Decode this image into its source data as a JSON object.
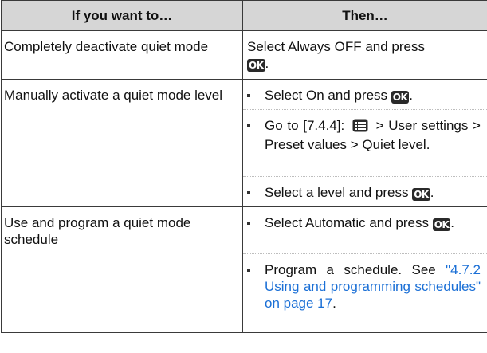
{
  "header": {
    "col1": "If you want to…",
    "col2": "Then…"
  },
  "rows": [
    {
      "want": "Completely deactivate quiet mode",
      "then": {
        "text": "Select Always OFF and press",
        "after_icon": "."
      }
    },
    {
      "want": "Manually activate a quiet mode level",
      "steps": [
        {
          "text": "Select On and press",
          "after_icon": "."
        },
        {
          "prefix": "Go to [7.4.4]:",
          "suffix": "> User settings > Preset values > Quiet level."
        },
        {
          "text": "Select a level and press",
          "after_icon": "."
        }
      ]
    },
    {
      "want": "Use and program a quiet mode schedule",
      "steps": [
        {
          "text": "Select Automatic and press",
          "after_icon": "."
        },
        {
          "text": "Program a schedule. See",
          "link": "\"4.7.2 Using and programming schedules\" on page 17",
          "after_link": "."
        }
      ]
    }
  ],
  "icons": {
    "ok_button": "ok-button-icon",
    "ok_label": "OK",
    "menu": "menu-icon"
  }
}
